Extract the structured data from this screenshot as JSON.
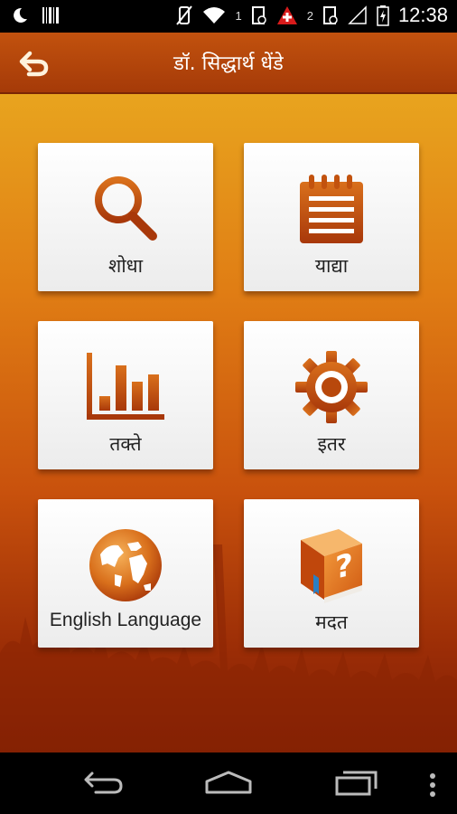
{
  "status_bar": {
    "time": "12:38",
    "sim_1": "1",
    "sim_2": "2"
  },
  "app_bar": {
    "title": "डॉ. सिद्धार्थ धेंडे"
  },
  "tiles": [
    {
      "label": "शोधा",
      "icon": "search-icon"
    },
    {
      "label": "याद्या",
      "icon": "list-icon"
    },
    {
      "label": "तक्ते",
      "icon": "bar-chart-icon"
    },
    {
      "label": "इतर",
      "icon": "gear-icon"
    },
    {
      "label": "English Language",
      "icon": "globe-icon"
    },
    {
      "label": "मदत",
      "icon": "help-book-icon"
    }
  ],
  "colors": {
    "accent": "#c2520e",
    "icon_brown": "#b0410a"
  }
}
